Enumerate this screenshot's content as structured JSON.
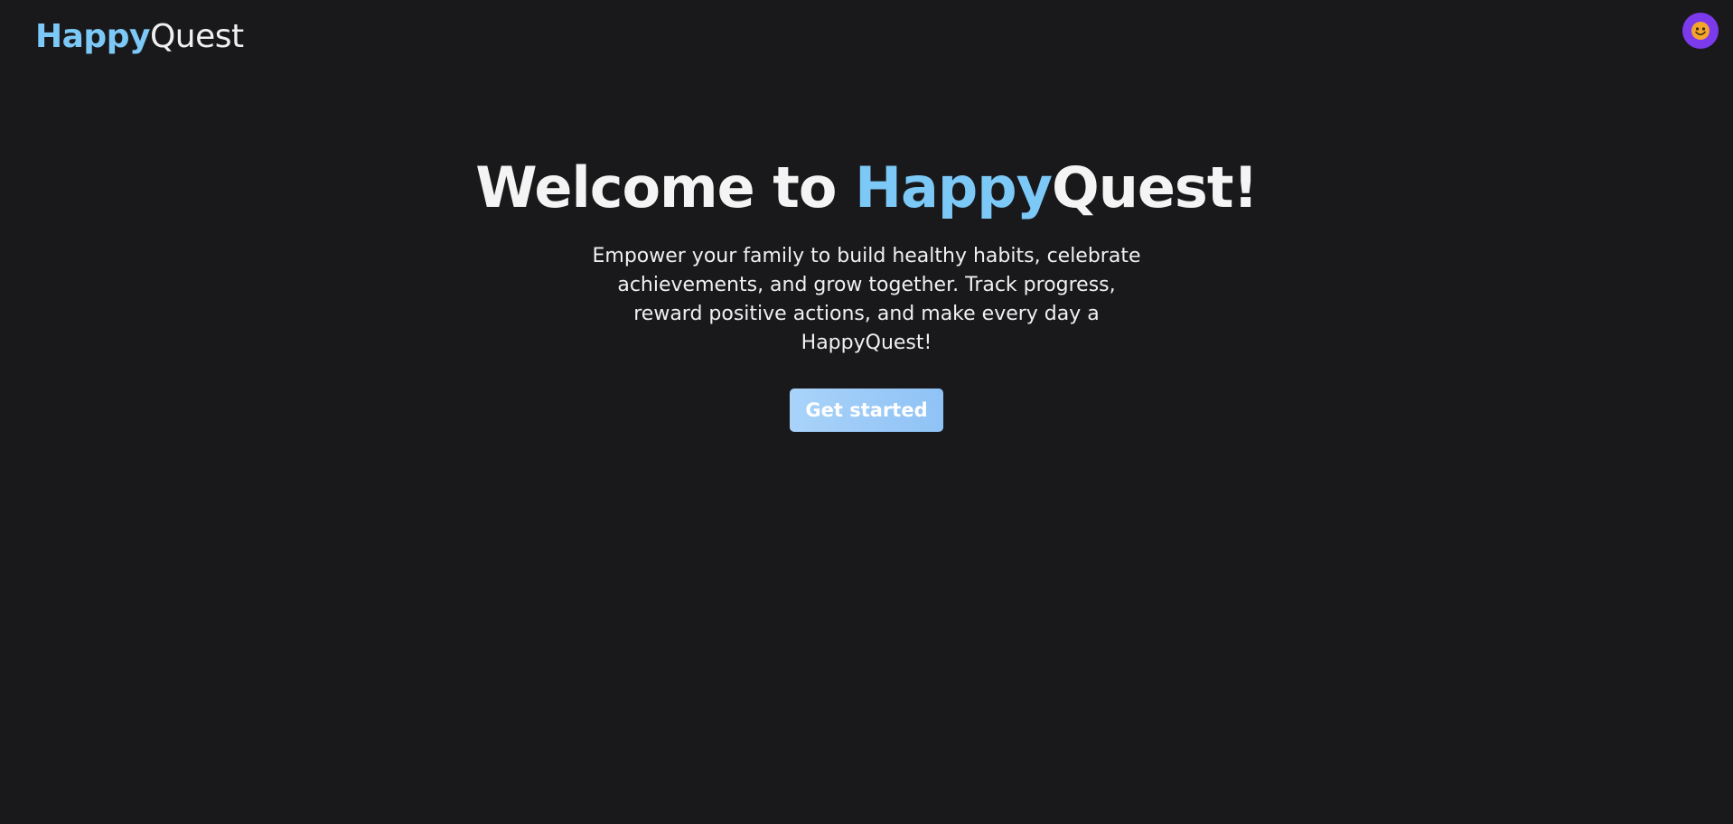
{
  "header": {
    "logo_part1": "Happy",
    "logo_part2": "Quest",
    "avatar_icon": "smiley-face-icon"
  },
  "hero": {
    "title_prefix": "Welcome to ",
    "title_accent": "Happy",
    "title_suffix": "Quest!",
    "subtitle": "Empower your family to build healthy habits, celebrate achievements, and grow together. Track progress, reward positive actions, and make every day a HappyQuest!",
    "cta_label": "Get started"
  },
  "colors": {
    "background": "#19191c",
    "accent": "#7cc8f6",
    "avatar": "#7c3aed",
    "button_gradient_start": "#a9d3f9",
    "button_gradient_end": "#8fc2f6"
  }
}
